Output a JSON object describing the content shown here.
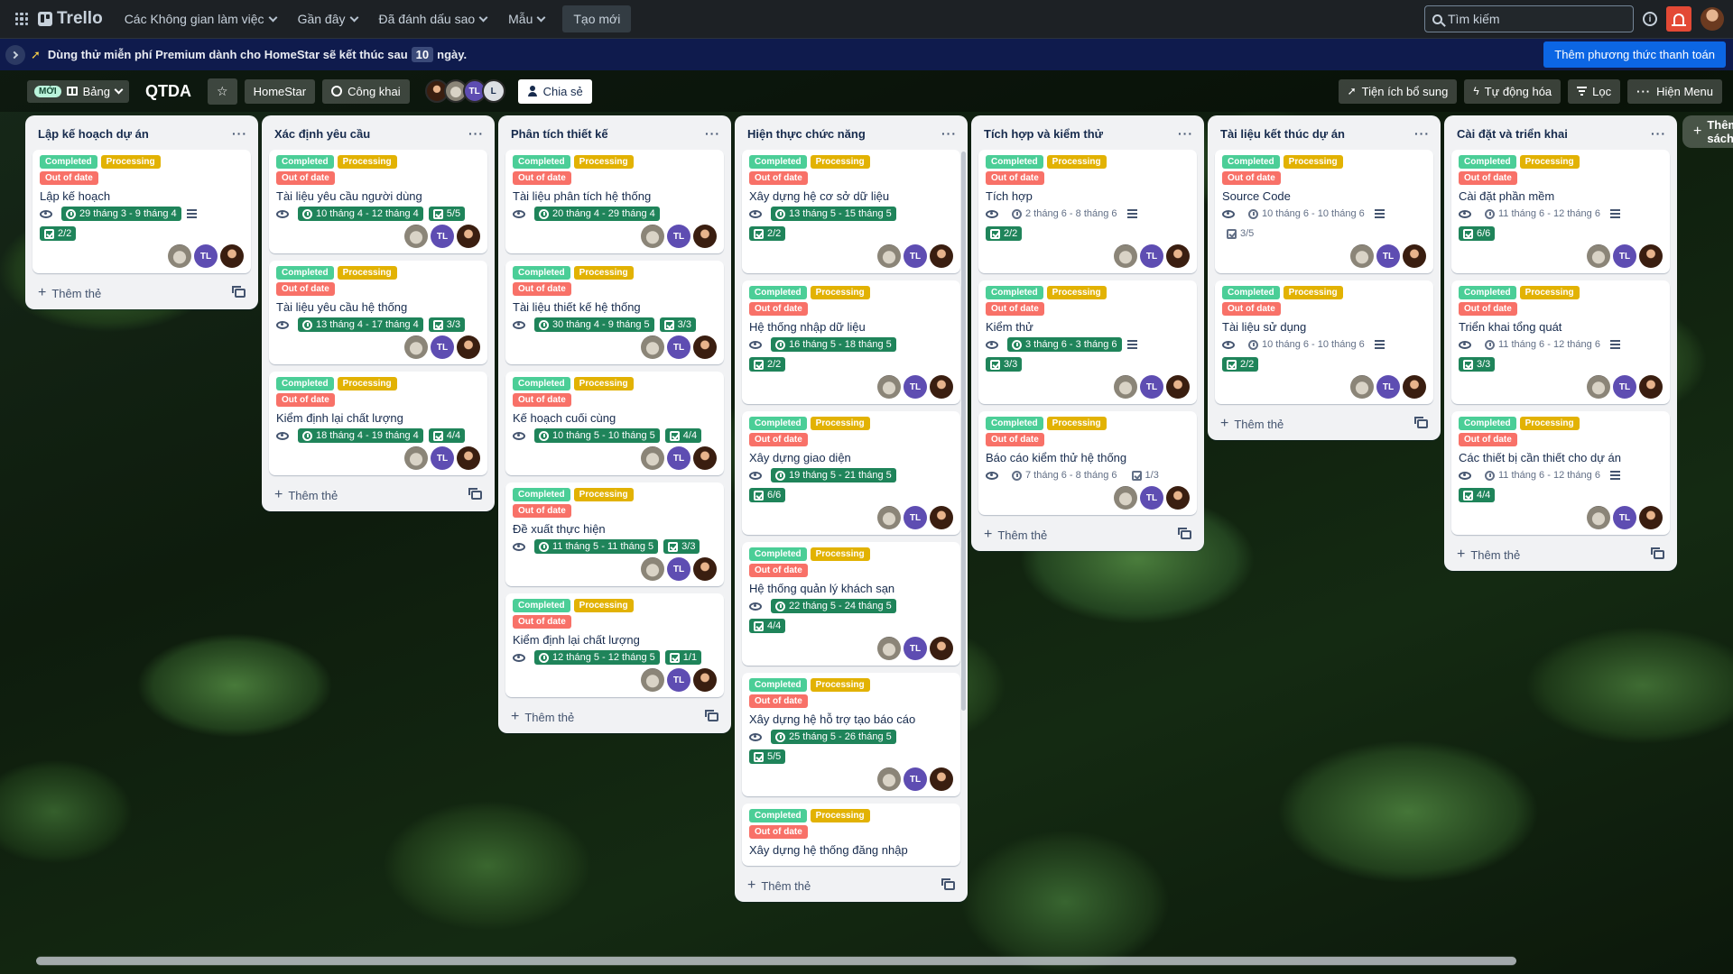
{
  "topbar": {
    "brand": "Trello",
    "nav": [
      "Các Không gian làm việc",
      "Gần đây",
      "Đã đánh dấu sao",
      "Mẫu"
    ],
    "create": "Tạo mới",
    "search_placeholder": "Tìm kiếm"
  },
  "banner": {
    "text_before": "Dùng thử miễn phí Premium dành cho HomeStar sẽ kết thúc sau",
    "days": "10",
    "text_after": "ngày.",
    "pay_button": "Thêm phương thức thanh toán"
  },
  "board": {
    "new_badge": "MỚI",
    "view": "Bảng",
    "title": "QTDA",
    "workspace": "HomeStar",
    "visibility": "Công khai",
    "member_initials": [
      "TL",
      "L"
    ],
    "share": "Chia sẻ",
    "powerups": "Tiện ích bổ sung",
    "automation": "Tự động hóa",
    "filter": "Lọc",
    "menu": "Hiện Menu",
    "add_list": "Thêm danh sách khác"
  },
  "labels": {
    "completed": "Completed",
    "processing": "Processing",
    "outdated": "Out of date"
  },
  "add_card": "Thêm thẻ",
  "colors": {
    "completed": "#4bce97",
    "processing": "#e2b203",
    "outdated": "#f87168",
    "due_complete": "#1f845a"
  },
  "lists": [
    {
      "title": "Lập kế hoạch dự án",
      "cards": [
        {
          "title": "Lập kế hoạch",
          "date": "29 tháng 3 - 9 tháng 4",
          "dateDone": true,
          "desc": true,
          "check": "2/2",
          "checkDone": true,
          "checkInline": false
        }
      ]
    },
    {
      "title": "Xác định yêu cầu",
      "cards": [
        {
          "title": "Tài liệu yêu cầu người dùng",
          "date": "10 tháng 4 - 12 tháng 4",
          "dateDone": true,
          "desc": false,
          "check": "5/5",
          "checkDone": true,
          "checkInline": true
        },
        {
          "title": "Tài liệu yêu cầu hệ thống",
          "date": "13 tháng 4 - 17 tháng 4",
          "dateDone": true,
          "desc": false,
          "check": "3/3",
          "checkDone": true,
          "checkInline": true
        },
        {
          "title": "Kiểm định lại chất lượng",
          "date": "18 tháng 4 - 19 tháng 4",
          "dateDone": true,
          "desc": false,
          "check": "4/4",
          "checkDone": true,
          "checkInline": true
        }
      ]
    },
    {
      "title": "Phân tích thiết kế",
      "cards": [
        {
          "title": "Tài liệu phân tích hệ thống",
          "date": "20 tháng 4 - 29 tháng 4",
          "dateDone": true,
          "desc": false,
          "check": "",
          "checkDone": true,
          "checkInline": true
        },
        {
          "title": "Tài liệu thiết kế hệ thống",
          "date": "30 tháng 4 - 9 tháng 5",
          "dateDone": true,
          "desc": false,
          "check": "3/3",
          "checkDone": true,
          "checkInline": true
        },
        {
          "title": "Kế hoạch cuối cùng",
          "date": "10 tháng 5 - 10 tháng 5",
          "dateDone": true,
          "desc": false,
          "check": "4/4",
          "checkDone": true,
          "checkInline": true
        },
        {
          "title": "Đề xuất thực hiện",
          "date": "11 tháng 5 - 11 tháng 5",
          "dateDone": true,
          "desc": false,
          "check": "3/3",
          "checkDone": true,
          "checkInline": true
        },
        {
          "title": "Kiểm định lại chất lượng",
          "date": "12 tháng 5 - 12 tháng 5",
          "dateDone": true,
          "desc": false,
          "check": "1/1",
          "checkDone": true,
          "checkInline": true
        }
      ]
    },
    {
      "title": "Hiện thực chức năng",
      "cards": [
        {
          "title": "Xây dựng hệ cơ sở dữ liệu",
          "date": "13 tháng 5 - 15 tháng 5",
          "dateDone": true,
          "desc": false,
          "check": "2/2",
          "checkDone": true,
          "checkInline": false
        },
        {
          "title": "Hệ thống nhập dữ liệu",
          "date": "16 tháng 5 - 18 tháng 5",
          "dateDone": true,
          "desc": false,
          "check": "2/2",
          "checkDone": true,
          "checkInline": false
        },
        {
          "title": "Xây dựng giao diện",
          "date": "19 tháng 5 - 21 tháng 5",
          "dateDone": true,
          "desc": false,
          "check": "6/6",
          "checkDone": true,
          "checkInline": false
        },
        {
          "title": "Hệ thống quản lý khách sạn",
          "date": "22 tháng 5 - 24 tháng 5",
          "dateDone": true,
          "desc": false,
          "check": "4/4",
          "checkDone": true,
          "checkInline": false
        },
        {
          "title": "Xây dựng hệ hỗ trợ tạo báo cáo",
          "date": "25 tháng 5 - 26 tháng 5",
          "dateDone": true,
          "desc": false,
          "check": "5/5",
          "checkDone": true,
          "checkInline": false
        },
        {
          "title": "Xây dựng hệ thống đăng nhập",
          "date": "",
          "dateDone": true,
          "desc": false,
          "check": "",
          "checkDone": true,
          "checkInline": false,
          "partial": true
        }
      ]
    },
    {
      "title": "Tích hợp và kiểm thử",
      "cards": [
        {
          "title": "Tích hợp",
          "date": "2 tháng 6 - 8 tháng 6",
          "dateDone": false,
          "desc": true,
          "check": "2/2",
          "checkDone": true,
          "checkInline": false
        },
        {
          "title": "Kiểm thử",
          "date": "3 tháng 6 - 3 tháng 6",
          "dateDone": true,
          "desc": true,
          "check": "3/3",
          "checkDone": true,
          "checkInline": false
        },
        {
          "title": "Báo cáo kiểm thử hệ thống",
          "date": "7 tháng 6 - 8 tháng 6",
          "dateDone": false,
          "desc": false,
          "check": "1/3",
          "checkDone": false,
          "checkInline": true
        }
      ]
    },
    {
      "title": "Tài liệu kết thúc dự án",
      "cards": [
        {
          "title": "Source Code",
          "date": "10 tháng 6 - 10 tháng 6",
          "dateDone": false,
          "desc": true,
          "check": "3/5",
          "checkDone": false,
          "checkInline": false
        },
        {
          "title": "Tài liệu sử dụng",
          "date": "10 tháng 6 - 10 tháng 6",
          "dateDone": false,
          "desc": true,
          "check": "2/2",
          "checkDone": true,
          "checkInline": false
        }
      ]
    },
    {
      "title": "Cài đặt và triển khai",
      "cards": [
        {
          "title": "Cài đặt phần mềm",
          "date": "11 tháng 6 - 12 tháng 6",
          "dateDone": false,
          "desc": true,
          "check": "6/6",
          "checkDone": true,
          "checkInline": false
        },
        {
          "title": "Triển khai tổng quát",
          "date": "11 tháng 6 - 12 tháng 6",
          "dateDone": false,
          "desc": true,
          "check": "3/3",
          "checkDone": true,
          "checkInline": false
        },
        {
          "title": "Các thiết bị cần thiết cho dự án",
          "date": "11 tháng 6 - 12 tháng 6",
          "dateDone": false,
          "desc": true,
          "check": "4/4",
          "checkDone": true,
          "checkInline": false
        }
      ]
    }
  ]
}
